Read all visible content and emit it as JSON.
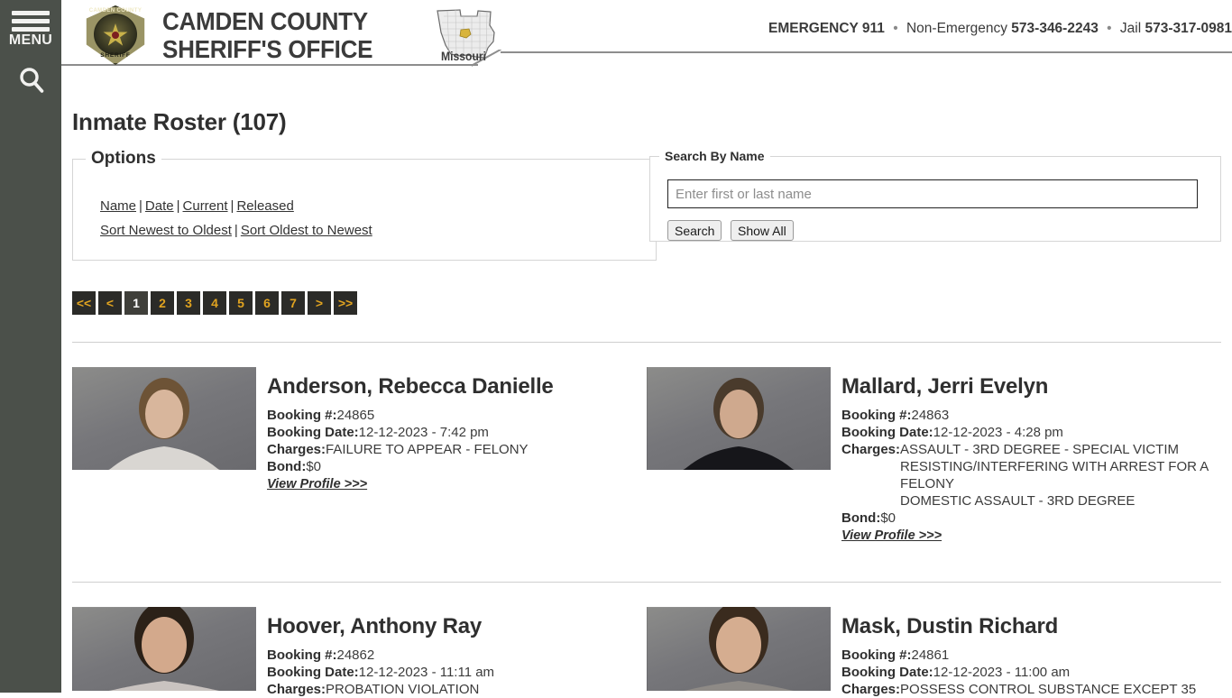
{
  "sidebar": {
    "menu_label": "MENU",
    "hamburger_icon": "hamburger-menu-icon",
    "search_icon": "search-icon"
  },
  "header": {
    "badge": {
      "top_text": "CAMDEN COUNTY",
      "bottom_text": "SHERIFF"
    },
    "site_title_line1": "CAMDEN COUNTY",
    "site_title_line2": "SHERIFF'S OFFICE",
    "map_label": "Missouri",
    "contacts": {
      "emergency": "EMERGENCY 911",
      "non_emergency_label": "Non-Emergency",
      "non_emergency_number": "573-346-2243",
      "jail_label": "Jail",
      "jail_number": "573-317-0981",
      "separator": "•"
    }
  },
  "main": {
    "page_title": "Inmate Roster (107)",
    "options": {
      "legend": "Options",
      "links_row1": [
        "Name",
        "Date",
        "Current",
        "Released"
      ],
      "links_row2": [
        "Sort Newest to Oldest",
        "Sort Oldest to Newest"
      ],
      "pipe": "|"
    },
    "search": {
      "legend": "Search By Name",
      "placeholder": "Enter first or last name",
      "value": "",
      "search_label": "Search",
      "show_all_label": "Show All"
    },
    "pagination": {
      "items": [
        {
          "label": "<<",
          "active": false
        },
        {
          "label": "<",
          "active": false
        },
        {
          "label": "1",
          "active": true
        },
        {
          "label": "2",
          "active": false
        },
        {
          "label": "3",
          "active": false
        },
        {
          "label": "4",
          "active": false
        },
        {
          "label": "5",
          "active": false
        },
        {
          "label": "6",
          "active": false
        },
        {
          "label": "7",
          "active": false
        },
        {
          "label": ">",
          "active": false
        },
        {
          "label": ">>",
          "active": false
        }
      ]
    },
    "labels": {
      "booking_no": "Booking #:",
      "booking_date": "Booking Date:",
      "charges": "Charges:",
      "bond": "Bond:",
      "view_profile": "View Profile >>>"
    },
    "inmates": [
      {
        "name": "Anderson, Rebecca Danielle",
        "booking_no": "24865",
        "booking_date": "12-12-2023 - 7:42 pm",
        "charges": [
          "FAILURE TO APPEAR - FELONY"
        ],
        "bond": "$0",
        "mug": {
          "skin": "#d8b69c",
          "hair": "#6d5336",
          "shirt": "#d9d6d2"
        }
      },
      {
        "name": "Mallard, Jerri Evelyn",
        "booking_no": "24863",
        "booking_date": "12-12-2023 - 4:28 pm",
        "charges": [
          "ASSAULT - 3RD DEGREE - SPECIAL VICTIM",
          "RESISTING/INTERFERING WITH ARREST FOR A FELONY",
          "DOMESTIC ASSAULT - 3RD DEGREE"
        ],
        "bond": "$0",
        "mug": {
          "skin": "#cfa98e",
          "hair": "#4a3b2c",
          "shirt": "#16161a"
        }
      },
      {
        "name": "Hoover, Anthony Ray",
        "booking_no": "24862",
        "booking_date": "12-12-2023 - 11:11 am",
        "charges": [
          "PROBATION VIOLATION"
        ],
        "bond": "",
        "mug": {
          "skin": "#d3a98c",
          "hair": "#2b2118",
          "shirt": "#c9c3c0"
        }
      },
      {
        "name": "Mask, Dustin Richard",
        "booking_no": "24861",
        "booking_date": "12-12-2023 - 11:00 am",
        "charges": [
          "POSSESS CONTROL SUBSTANCE EXCEPT 35"
        ],
        "bond": "",
        "mug": {
          "skin": "#d5ad90",
          "hair": "#3a2b1e",
          "shirt": "#8e8a86"
        }
      }
    ]
  },
  "colors": {
    "sidebar": "#4b504a",
    "accent_gold": "#e0a320",
    "pager_bg": "#2b2b28",
    "pager_active_bg": "#3f3f3a",
    "text": "#333333"
  }
}
